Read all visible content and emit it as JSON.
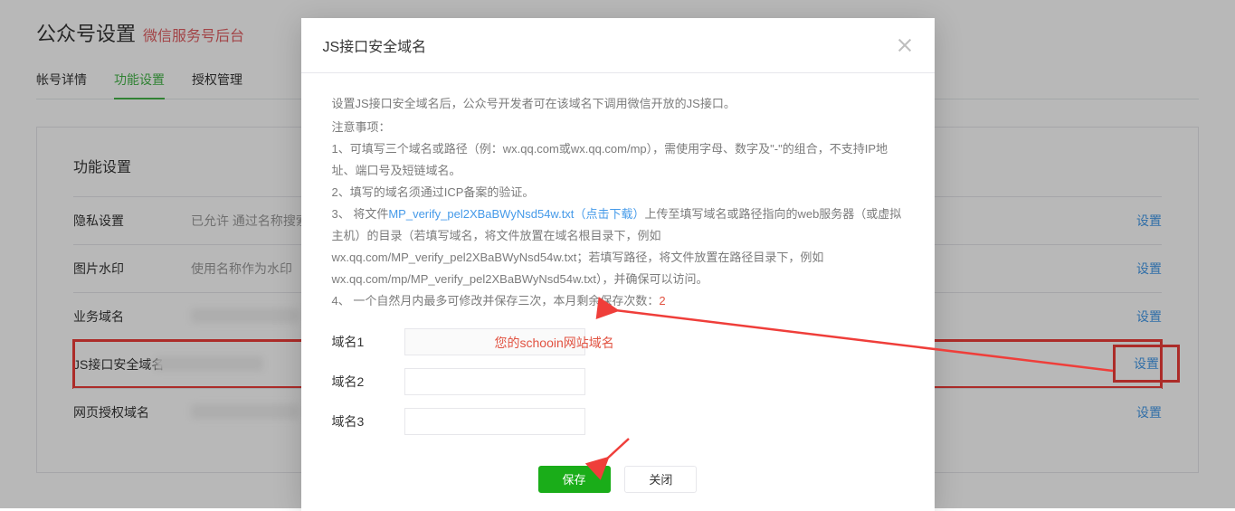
{
  "header": {
    "title": "公众号设置",
    "subtitle": "微信服务号后台"
  },
  "tabs": {
    "items": [
      {
        "label": "帐号详情",
        "active": false
      },
      {
        "label": "功能设置",
        "active": true
      },
      {
        "label": "授权管理",
        "active": false
      }
    ]
  },
  "panel": {
    "title": "功能设置",
    "action_label": "设置",
    "rows": [
      {
        "label": "隐私设置",
        "value": "已允许 通过名称搜索到本帐号"
      },
      {
        "label": "图片水印",
        "value": "使用名称作为水印"
      },
      {
        "label": "业务域名",
        "value": ""
      },
      {
        "label": "JS接口安全域名",
        "value": ""
      },
      {
        "label": "网页授权域名",
        "value": ""
      }
    ]
  },
  "modal": {
    "title": "JS接口安全域名",
    "intro": "设置JS接口安全域名后，公众号开发者可在该域名下调用微信开放的JS接口。",
    "note_head": "注意事项：",
    "note1": "1、可填写三个域名或路径（例：wx.qq.com或wx.qq.com/mp），需使用字母、数字及\"-\"的组合，不支持IP地址、端口号及短链域名。",
    "note2": "2、填写的域名须通过ICP备案的验证。",
    "note3_a": "3、 将文件",
    "note3_file": "MP_verify_pel2XBaBWyNsd54w.txt",
    "note3_dl": "（点击下载）",
    "note3_b": "上传至填写域名或路径指向的web服务器（或虚拟主机）的目录（若填写域名，将文件放置在域名根目录下，例如wx.qq.com/MP_verify_pel2XBaBWyNsd54w.txt；若填写路径，将文件放置在路径目录下，例如wx.qq.com/mp/MP_verify_pel2XBaBWyNsd54w.txt），并确保可以访问。",
    "note4_a": "4、 一个自然月内最多可修改并保存三次，本月剩余保存次数：",
    "note4_count": "2",
    "domain_labels": [
      "域名1",
      "域名2",
      "域名3"
    ],
    "annot_domain1": "您的schooin网站域名",
    "buttons": {
      "save": "保存",
      "close": "关闭"
    }
  }
}
